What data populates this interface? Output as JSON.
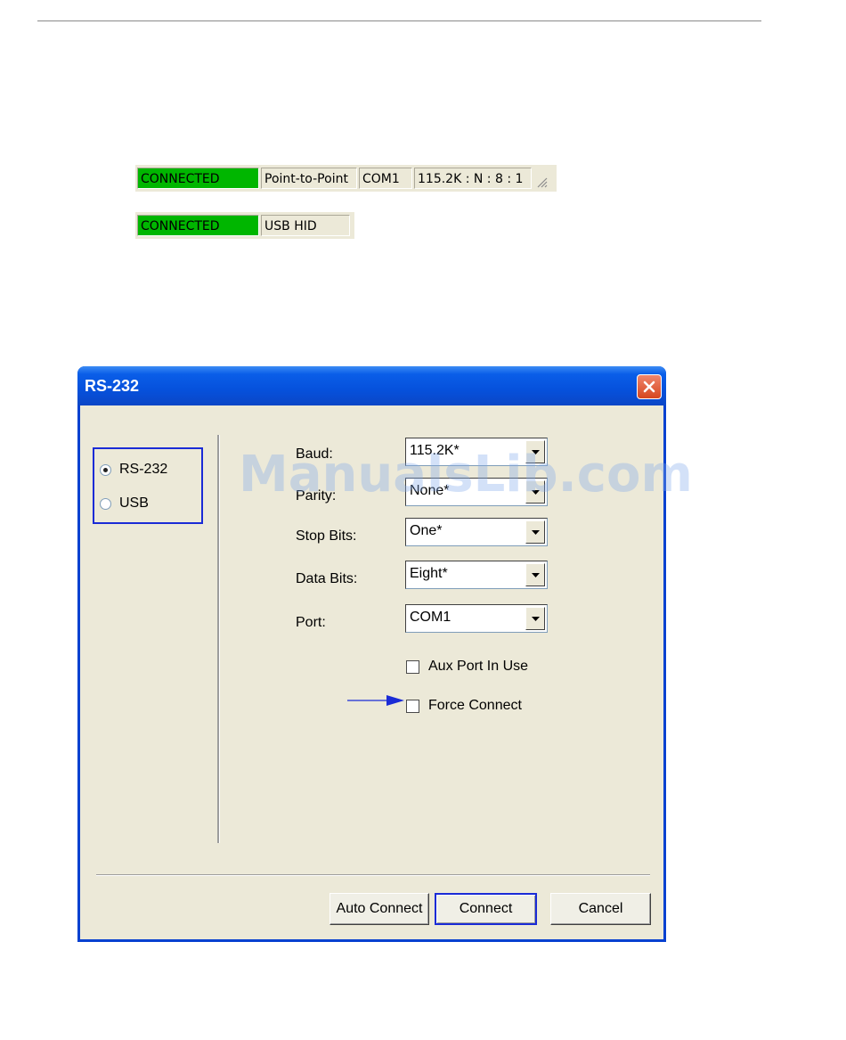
{
  "status_bar_rs232": {
    "state": "CONNECTED",
    "mode": "Point-to-Point",
    "port": "COM1",
    "settings": "115.2K : N : 8 : 1"
  },
  "status_bar_usb": {
    "state": "CONNECTED",
    "mode": "USB HID"
  },
  "dialog": {
    "title": "RS-232",
    "interface_options": {
      "rs232": {
        "label": "RS-232",
        "selected": true
      },
      "usb": {
        "label": "USB",
        "selected": false
      }
    },
    "fields": {
      "baud": {
        "label": "Baud:",
        "value": "115.2K*"
      },
      "parity": {
        "label": "Parity:",
        "value": "None*"
      },
      "stop_bits": {
        "label": "Stop Bits:",
        "value": "One*"
      },
      "data_bits": {
        "label": "Data Bits:",
        "value": "Eight*"
      },
      "port": {
        "label": "Port:",
        "value": "COM1"
      }
    },
    "checkboxes": {
      "aux_port": {
        "label": "Aux Port In Use",
        "checked": false
      },
      "force_connect": {
        "label": "Force Connect",
        "checked": false
      }
    },
    "buttons": {
      "auto_connect": "Auto Connect",
      "connect": "Connect",
      "cancel": "Cancel"
    }
  },
  "watermark": "ManualsLib.com",
  "colors": {
    "connected_green": "#00b600",
    "titlebar_blue": "#0651dc",
    "highlight_blue": "#1a2bd6",
    "dialog_bg": "#ece9d8"
  }
}
